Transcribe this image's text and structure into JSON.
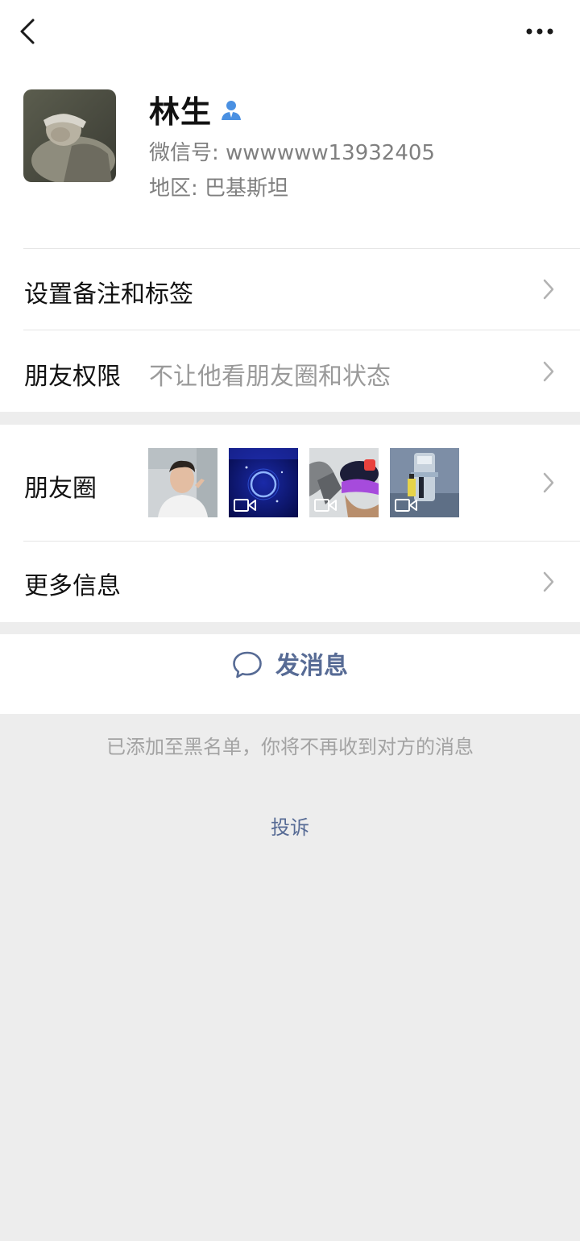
{
  "profile": {
    "name": "林生",
    "wechat_id": "微信号: wwwwww13932405",
    "region": "地区: 巴基斯坦",
    "gender_icon": "male-user-icon"
  },
  "rows": {
    "remark": {
      "label": "设置备注和标签"
    },
    "permissions": {
      "label": "朋友权限",
      "value": "不让他看朋友圈和状态"
    },
    "moments": {
      "label": "朋友圈",
      "thumbnails": [
        {
          "name": "selfie-photo",
          "has_video": false
        },
        {
          "name": "blue-ring-video",
          "has_video": true
        },
        {
          "name": "cap-portrait-video",
          "has_video": true
        },
        {
          "name": "figure-video",
          "has_video": true
        }
      ]
    },
    "more_info": {
      "label": "更多信息"
    }
  },
  "actions": {
    "send_message": "发消息",
    "blacklist_note": "已添加至黑名单，你将不再收到对方的消息",
    "complain": "投诉"
  },
  "colors": {
    "link_blue": "#576b95",
    "background": "#ededed",
    "card": "#ffffff"
  }
}
